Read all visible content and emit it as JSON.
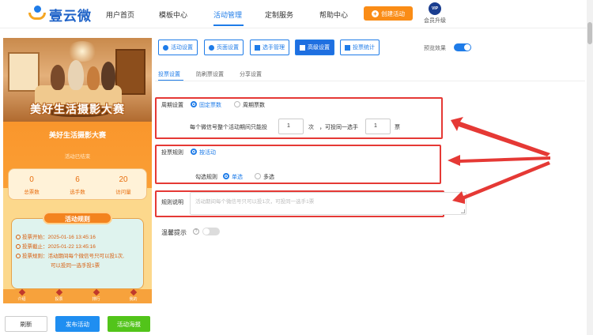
{
  "brand": {
    "name": "壹云微"
  },
  "nav": {
    "items": [
      "用户首页",
      "模板中心",
      "活动管理",
      "定制服务",
      "帮助中心"
    ],
    "create_label": "创建活动",
    "vip_badge": "VIP",
    "vip_label": "会员升级"
  },
  "preview": {
    "banner_title": "美好生活摄影大赛",
    "band_title": "美好生活摄影大赛",
    "status": "活动已结束",
    "stats": [
      {
        "value": "0",
        "label": "总票数"
      },
      {
        "value": "6",
        "label": "选手数"
      },
      {
        "value": "20",
        "label": "访问量"
      }
    ],
    "rules_title": "活动规则",
    "rules": [
      "投票开始：2025-01-16 13:45:16",
      "投票截止：2025-01-22 13:45:16",
      "投票规则：活动期间每个微信号只可以投1次,",
      "可以投同一选手投1票"
    ],
    "tabs": [
      "介绍",
      "投票",
      "排行",
      "我的"
    ]
  },
  "left_buttons": {
    "refresh": "刷新",
    "publish": "发布活动",
    "poster": "活动海报"
  },
  "toolbar": {
    "buttons": [
      "活动设置",
      "页面设置",
      "选手管理",
      "高级设置",
      "投票统计"
    ],
    "preview_label": "预览效果"
  },
  "subtabs": [
    "投票设置",
    "防刷票设置",
    "分享设置"
  ],
  "form": {
    "cycle_label": "周期设置",
    "cycle_options": [
      "固定票数",
      "周期票数"
    ],
    "limit_prefix": "每个微信号整个活动期间只能投",
    "limit_total": "1",
    "limit_unit": "次",
    "limit_mid": "，可投同一选手",
    "limit_same": "1",
    "limit_unit2": "票",
    "vote_rule_label": "投票规则",
    "vote_rule_option": "按活动",
    "check_rule_label": "勾选规则",
    "check_options": [
      "单选",
      "多选"
    ],
    "desc_label": "规则说明",
    "desc_placeholder": "活动期间每个微信号只可以投1次，可投同一选手1票",
    "tip_label": "温馨提示",
    "help_glyph": "?"
  },
  "colors": {
    "accent": "#1f7ce8",
    "orange": "#fa8c16",
    "highlight": "#e53935"
  }
}
